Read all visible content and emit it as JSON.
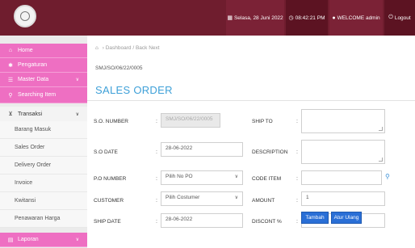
{
  "topbar": {
    "date": "Selasa, 28 Juni 2022",
    "time": "08:42:21 PM",
    "user": "WELCOME admin",
    "logout": "Logout"
  },
  "sidebar": {
    "home": "Home",
    "pengaturan": "Pengaturan",
    "master_data": "Master Data",
    "searching_item": "Searching Item",
    "transaksi": "Transaksi",
    "sub_items": [
      "Barang Masuk",
      "Sales Order",
      "Delivery Order",
      "Invoice",
      "Kwitansi",
      "Penawaran Harga"
    ],
    "laporan": "Laporan"
  },
  "breadcrumb": {
    "dashboard": "Dashboard",
    "back": "Back",
    "next": "Next"
  },
  "doc_number": "SMJ/SO/06/22/0005",
  "page_title": "SALES ORDER",
  "form": {
    "so_number_label": "S.O. NUMBER",
    "so_number_value": "SMJ/SO/06/22/0005",
    "so_date_label": "S.O DATE",
    "so_date_value": "28-06-2022",
    "po_number_label": "P.O NUMBER",
    "po_number_value": "Pilih No PO",
    "customer_label": "CUSTOMER",
    "customer_value": "Pilih Costumer",
    "ship_date_label": "SHIP DATE",
    "ship_date_value": "28-06-2022",
    "ship_to_label": "SHIP TO",
    "ship_to_value": "",
    "description_label": "DESCRIPTION",
    "description_value": "",
    "code_item_label": "CODE ITEM",
    "code_item_value": "",
    "amount_label": "AMOUNT",
    "amount_value": "1",
    "discount_label": "DISCONT %",
    "discount_value": "0"
  },
  "buttons": {
    "tambah": "Tambah",
    "atur_ulang": "Atur Ulang"
  }
}
